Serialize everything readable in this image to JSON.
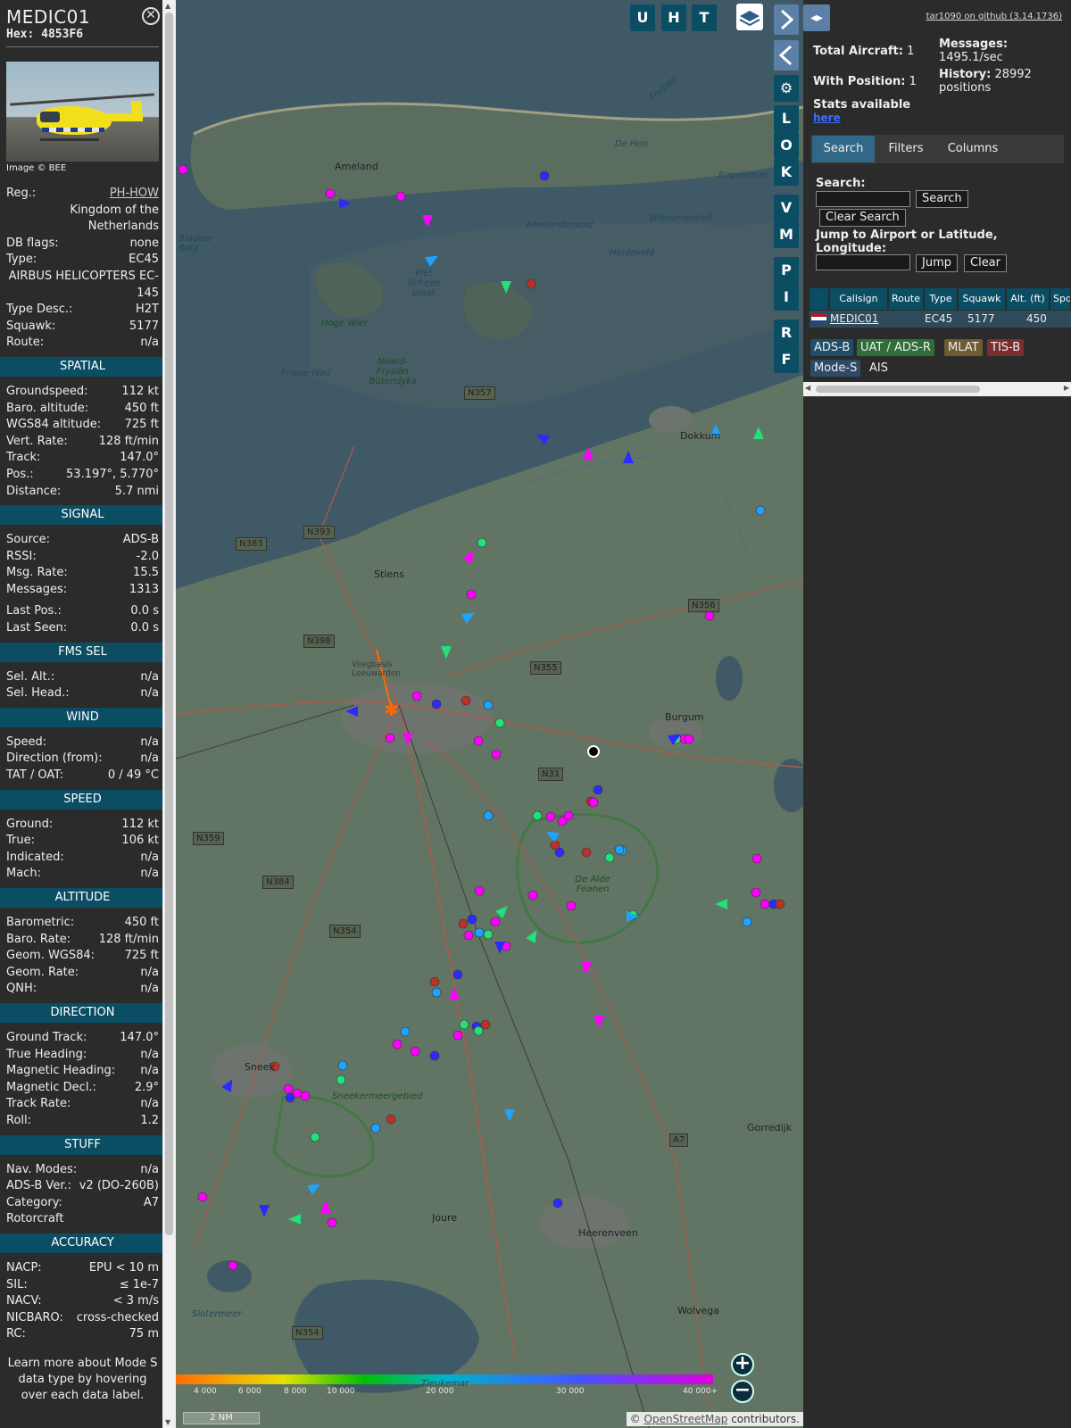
{
  "aircraft": {
    "callsign": "MEDIC01",
    "hex": "Hex: 4853F6",
    "image_credit": "Image © BEE",
    "details": [
      {
        "label": "Reg.:",
        "value": "PH-HOW",
        "link": true
      },
      {
        "label": "",
        "value": "Kingdom of the Netherlands",
        "stack": true
      },
      {
        "label": "DB flags:",
        "value": "none"
      },
      {
        "label": "Type:",
        "value": "EC45"
      },
      {
        "label": "",
        "value": "AIRBUS HELICOPTERS EC-145",
        "stack": true
      },
      {
        "label": "Type Desc.:",
        "value": "H2T"
      },
      {
        "label": "Squawk:",
        "value": "5177"
      },
      {
        "label": "Route:",
        "value": "n/a"
      }
    ]
  },
  "sections": [
    {
      "title": "SPATIAL",
      "rows": [
        {
          "label": "Groundspeed:",
          "value": "112 kt"
        },
        {
          "label": "Baro. altitude:",
          "value": "450 ft"
        },
        {
          "label": "WGS84 altitude:",
          "value": "725 ft"
        },
        {
          "label": "Vert. Rate:",
          "value": "128 ft/min"
        },
        {
          "label": "Track:",
          "value": "147.0°"
        },
        {
          "label": "Pos.:",
          "value": "53.197°, 5.770°"
        },
        {
          "label": "Distance:",
          "value": "5.7 nmi"
        }
      ]
    },
    {
      "title": "SIGNAL",
      "rows": [
        {
          "label": "Source:",
          "value": "ADS-B"
        },
        {
          "label": "RSSI:",
          "value": "-2.0"
        },
        {
          "label": "Msg. Rate:",
          "value": "15.5"
        },
        {
          "label": "Messages:",
          "value": "1313"
        },
        {
          "label": "",
          "value": ""
        },
        {
          "label": "Last Pos.:",
          "value": "0.0 s"
        },
        {
          "label": "Last Seen:",
          "value": "0.0 s"
        }
      ]
    },
    {
      "title": "FMS SEL",
      "rows": [
        {
          "label": "Sel. Alt.:",
          "value": "n/a"
        },
        {
          "label": "Sel. Head.:",
          "value": "n/a"
        }
      ]
    },
    {
      "title": "WIND",
      "rows": [
        {
          "label": "Speed:",
          "value": "n/a"
        },
        {
          "label": "Direction (from):",
          "value": "n/a"
        },
        {
          "label": "TAT / OAT:",
          "value": "0 / 49 °C"
        }
      ]
    },
    {
      "title": "SPEED",
      "rows": [
        {
          "label": "Ground:",
          "value": "112 kt"
        },
        {
          "label": "True:",
          "value": "106 kt"
        },
        {
          "label": "Indicated:",
          "value": "n/a"
        },
        {
          "label": "Mach:",
          "value": "n/a"
        }
      ]
    },
    {
      "title": "ALTITUDE",
      "rows": [
        {
          "label": "Barometric:",
          "value": "450 ft"
        },
        {
          "label": "Baro. Rate:",
          "value": "128 ft/min"
        },
        {
          "label": "Geom. WGS84:",
          "value": "725 ft"
        },
        {
          "label": "Geom. Rate:",
          "value": "n/a"
        },
        {
          "label": "QNH:",
          "value": "n/a"
        }
      ]
    },
    {
      "title": "DIRECTION",
      "rows": [
        {
          "label": "Ground Track:",
          "value": "147.0°"
        },
        {
          "label": "True Heading:",
          "value": "n/a"
        },
        {
          "label": "Magnetic Heading:",
          "value": "n/a"
        },
        {
          "label": "Magnetic Decl.:",
          "value": "2.9°"
        },
        {
          "label": "Track Rate:",
          "value": "n/a"
        },
        {
          "label": "Roll:",
          "value": "1.2"
        }
      ]
    },
    {
      "title": "STUFF",
      "rows": [
        {
          "label": "Nav. Modes:",
          "value": "n/a"
        },
        {
          "label": "ADS-B Ver.:",
          "value": "v2 (DO-260B)"
        },
        {
          "label": "Category:",
          "value": "A7"
        },
        {
          "label": "Rotorcraft",
          "value": ""
        }
      ]
    },
    {
      "title": "ACCURACY",
      "rows": [
        {
          "label": "NACP:",
          "value": "EPU < 10 m"
        },
        {
          "label": "SIL:",
          "value": "≤ 1e-7"
        },
        {
          "label": "NACV:",
          "value": "< 3 m/s"
        },
        {
          "label": "NICBARO:",
          "value": "cross-checked"
        },
        {
          "label": "RC:",
          "value": "75 m"
        }
      ]
    }
  ],
  "learn_more": "Learn more about Mode S data type by hovering over each data label.",
  "map": {
    "top_buttons": [
      "U",
      "H",
      "T"
    ],
    "side_buttons": [
      "L",
      "O",
      "K",
      "V",
      "M",
      "P",
      "I",
      "R",
      "F"
    ],
    "places": [
      {
        "name": "Ameland",
        "kind": "town"
      },
      {
        "name": "Dokkum",
        "kind": "town"
      },
      {
        "name": "Stiens",
        "kind": "town"
      },
      {
        "name": "Burgum",
        "kind": "town"
      },
      {
        "name": "Sneek",
        "kind": "town"
      },
      {
        "name": "Joure",
        "kind": "town"
      },
      {
        "name": "Heerenveen",
        "kind": "town"
      },
      {
        "name": "Gorredijk",
        "kind": "town"
      },
      {
        "name": "Wolvega",
        "kind": "town"
      },
      {
        "name": "Amelanderwad",
        "kind": "water"
      },
      {
        "name": "Wierumerwad",
        "kind": "water"
      },
      {
        "name": "Piet Scheve plaat",
        "kind": "water"
      },
      {
        "name": "Friese Wad",
        "kind": "water"
      },
      {
        "name": "Blauwe Balg",
        "kind": "water"
      },
      {
        "name": "Engelsman",
        "kind": "water"
      },
      {
        "name": "Tjeukemar",
        "kind": "water"
      },
      {
        "name": "Slotermeer",
        "kind": "water"
      },
      {
        "name": "De Hon",
        "kind": "water"
      },
      {
        "name": "Frysian",
        "kind": "water"
      },
      {
        "name": "Heideveld",
        "kind": "water"
      },
      {
        "name": "Hoge Wier",
        "kind": "green"
      },
      {
        "name": "Noard-Fryslân Bûtendyks",
        "kind": "green"
      },
      {
        "name": "De Alde Feanen",
        "kind": "green"
      },
      {
        "name": "Sneekermeergebied",
        "kind": "green"
      },
      {
        "name": "Vliegbasis Leeuwarden",
        "kind": "town"
      },
      {
        "name": "Leeuwarden",
        "kind": "town"
      }
    ],
    "road_numbers": [
      "N357",
      "N393",
      "N383",
      "N356",
      "N398",
      "N355",
      "N31",
      "N359",
      "N384",
      "N354",
      "A7",
      "N354"
    ],
    "altitude_scale": [
      "4 000",
      "6 000",
      "8 000",
      "10 000",
      "20 000",
      "30 000",
      "40 000+"
    ],
    "scale_label": "2 NM",
    "attribution_prefix": "©",
    "attribution_link": "OpenStreetMap",
    "attribution_suffix": "contributors."
  },
  "panel": {
    "github_link": "tar1090 on github (3.14.1736)",
    "total_aircraft_label": "Total Aircraft:",
    "total_aircraft": "1",
    "with_position_label": "With Position:",
    "with_position": "1",
    "stats_label": "Stats available",
    "stats_link": "here",
    "messages_label": "Messages:",
    "messages_rate": "1495.1/sec",
    "history_label": "History:",
    "history_value": "28992",
    "history_unit": "positions",
    "tabs": [
      "Search",
      "Filters",
      "Columns"
    ],
    "search_label": "Search:",
    "search_button": "Search",
    "clear_search_button": "Clear Search",
    "jump_label": "Jump to Airport or Latitude, Longitude:",
    "jump_button": "Jump",
    "clear_button": "Clear",
    "table_headers": [
      "Callsign",
      "Route",
      "Type",
      "Squawk",
      "Alt. (ft)",
      "Spd"
    ],
    "table_rows": [
      {
        "callsign": "MEDIC01",
        "route": "",
        "type": "EC45",
        "squawk": "5177",
        "alt": "450",
        "spd": ""
      }
    ],
    "sources": [
      {
        "name": "ADS-B",
        "color": "#1f4e69"
      },
      {
        "name": "UAT / ADS-R",
        "color": "#2f6e3a"
      },
      {
        "name": "MLAT",
        "color": "#6e5a33"
      },
      {
        "name": "TIS-B",
        "color": "#7a2f2f"
      },
      {
        "name": "Mode-S",
        "color": "#2f4a69"
      },
      {
        "name": "AIS",
        "color": "#2b2b2b"
      }
    ]
  },
  "colors": {
    "accent": "#0b4d63",
    "active_tab": "#326887",
    "selected_track": "#ff6a00"
  }
}
